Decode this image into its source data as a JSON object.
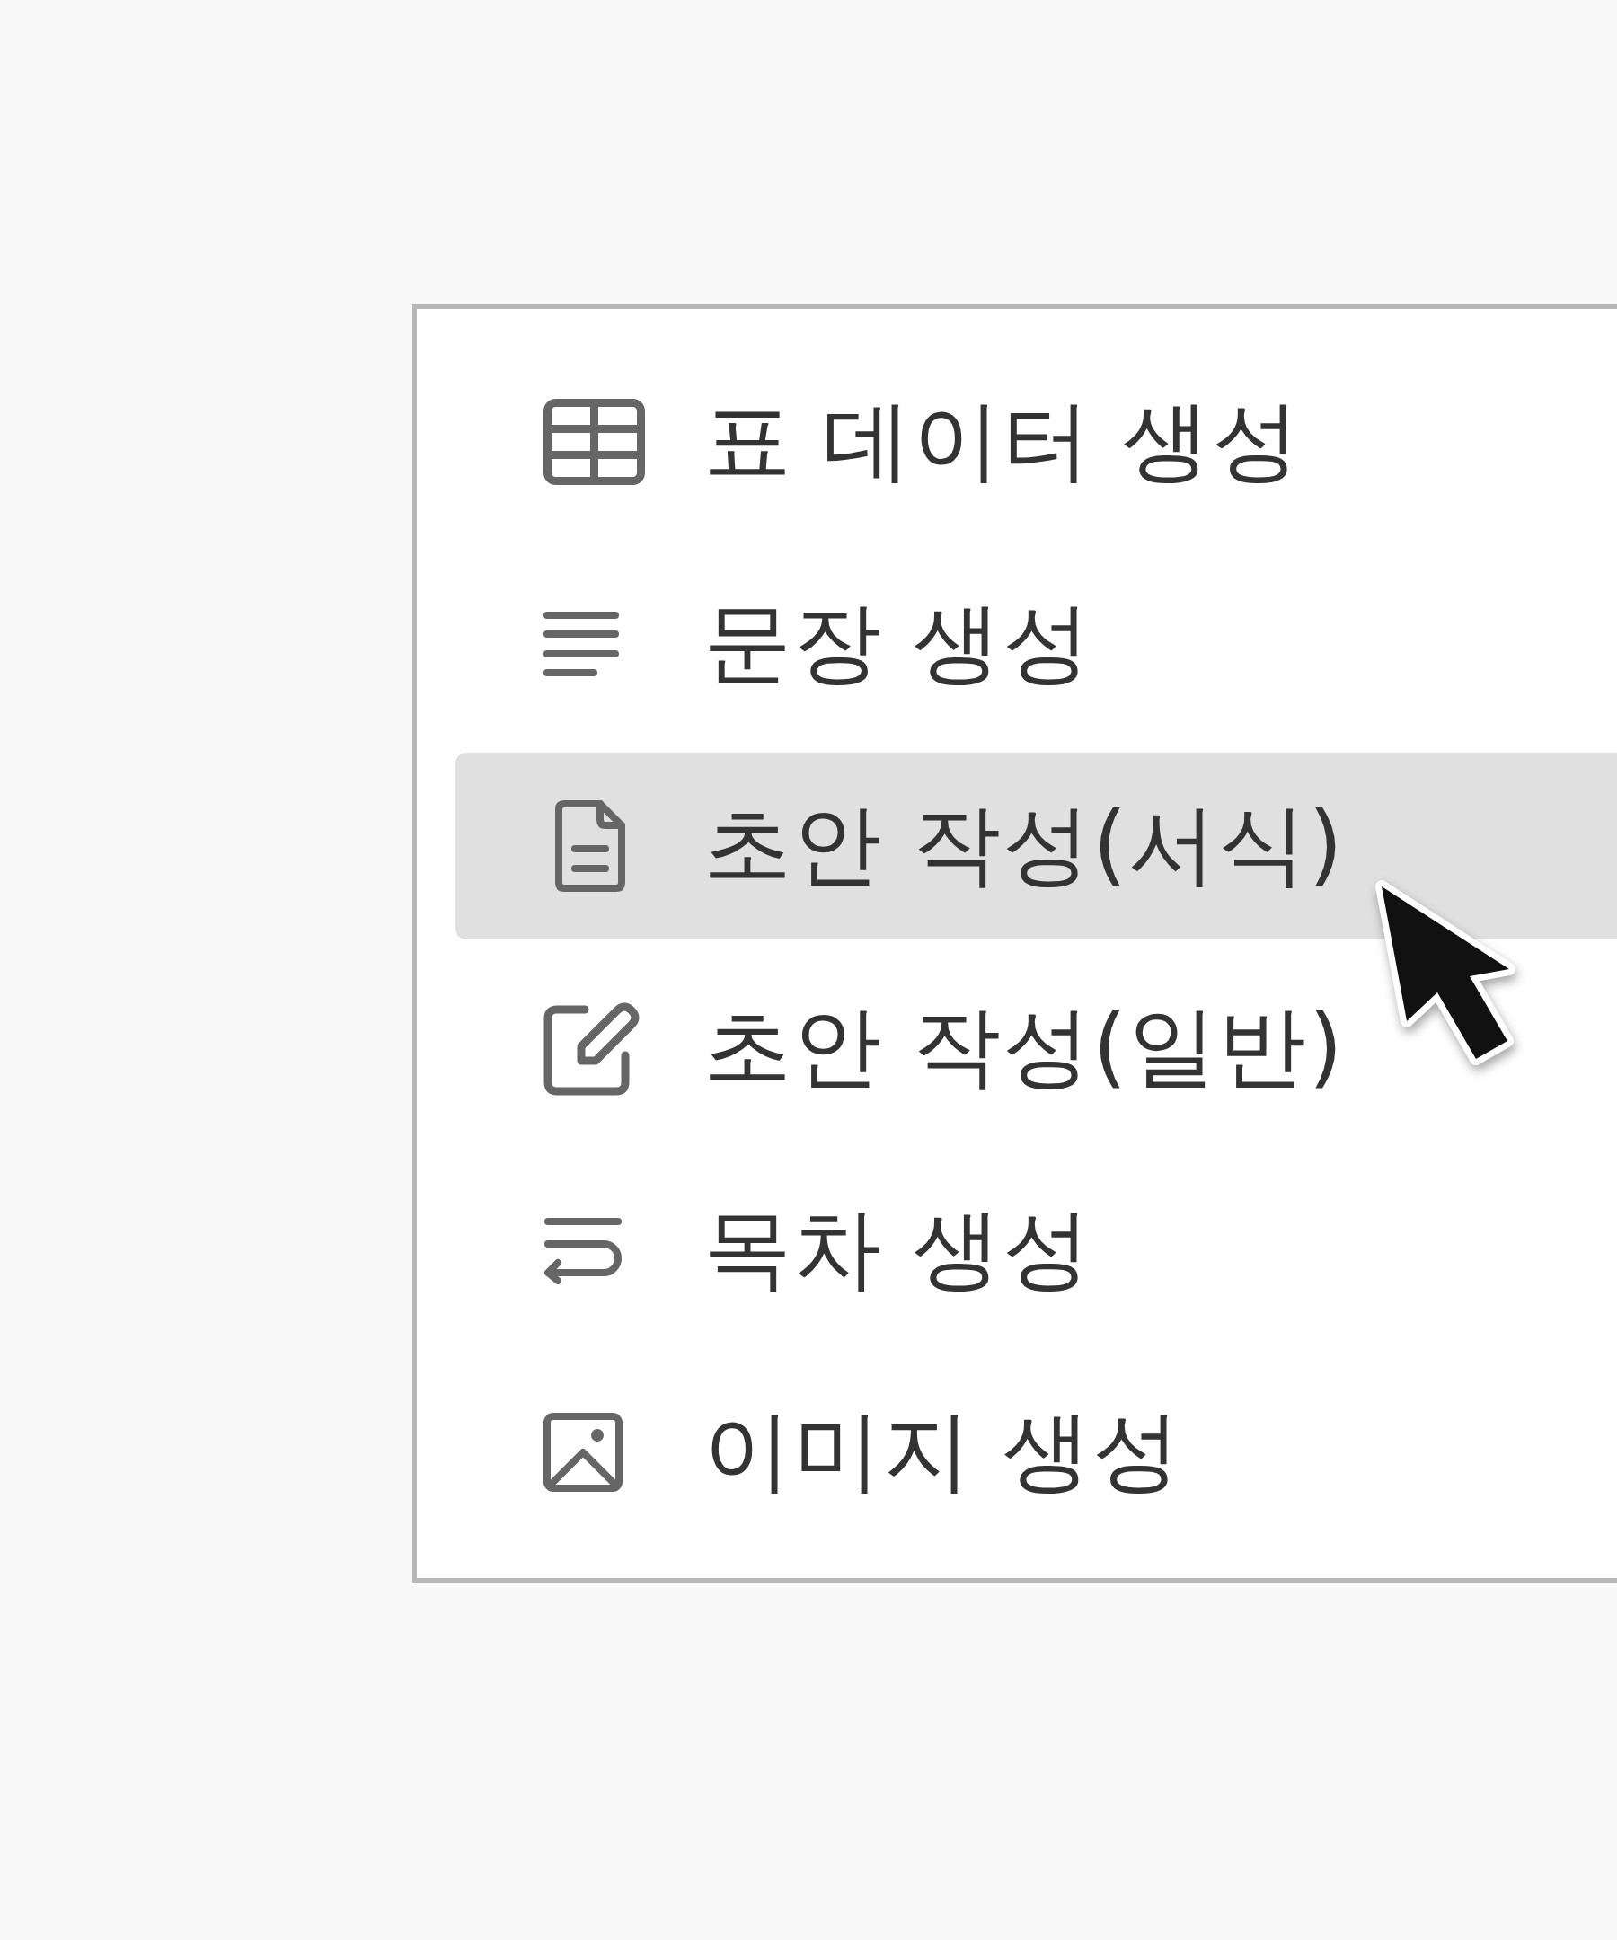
{
  "menu": {
    "items": [
      {
        "kind": "table",
        "label": "표 데이터 생성",
        "selected": false
      },
      {
        "kind": "paragraph",
        "label": "문장 생성",
        "selected": false
      },
      {
        "kind": "document",
        "label": "초안 작성(서식)",
        "selected": true
      },
      {
        "kind": "edit",
        "label": "초안 작성(일반)",
        "selected": false
      },
      {
        "kind": "toc",
        "label": "목차 생성",
        "selected": false
      },
      {
        "kind": "image",
        "label": "이미지 생성",
        "selected": false
      }
    ]
  }
}
